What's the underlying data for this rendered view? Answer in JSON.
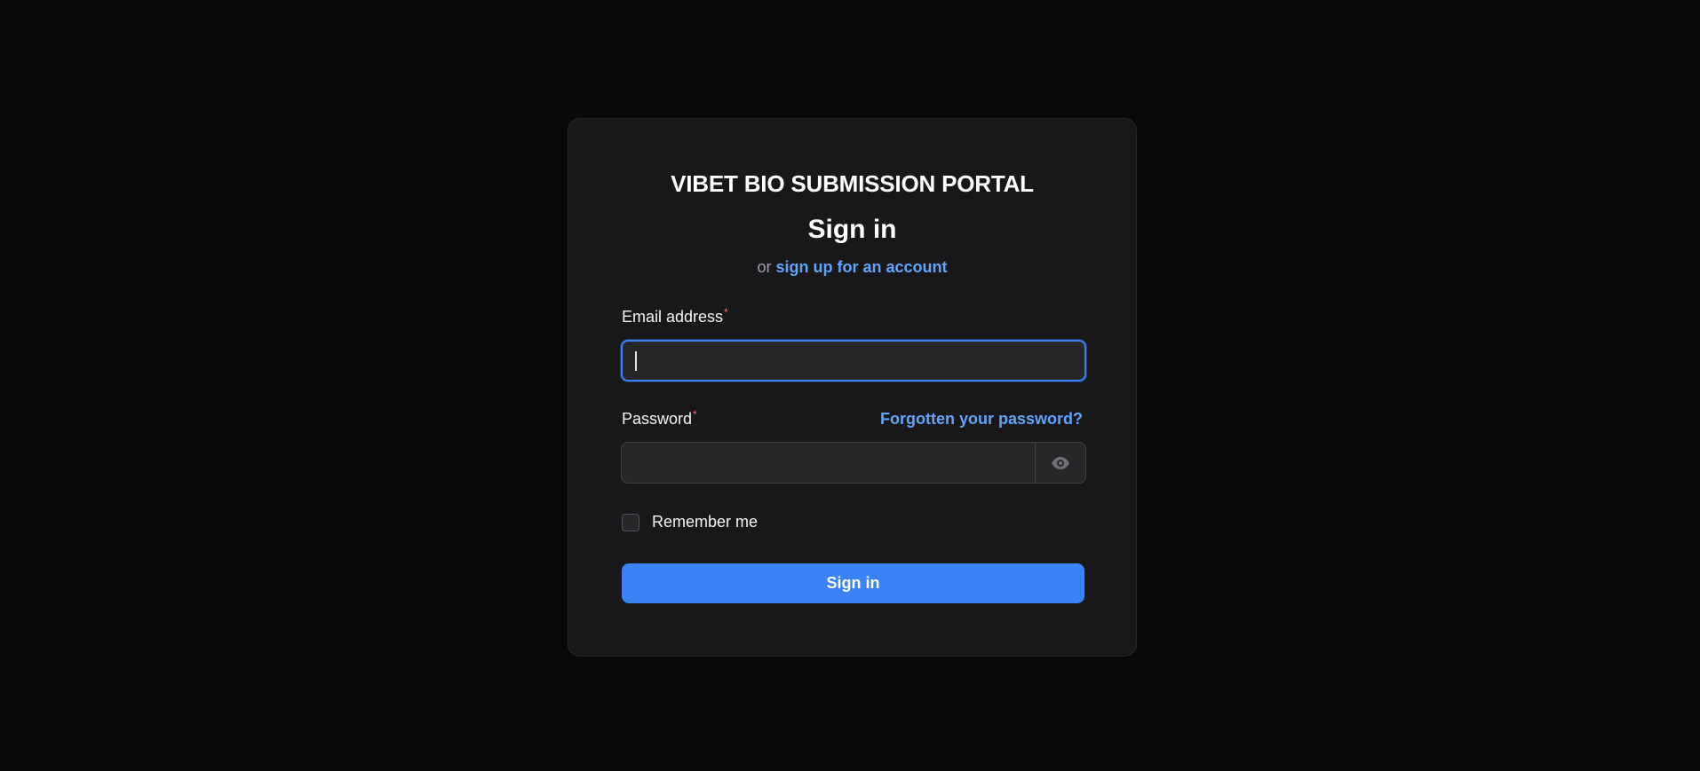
{
  "brand": {
    "title": "VIBET BIO SUBMISSION PORTAL"
  },
  "form": {
    "heading": "Sign in",
    "subline_prefix": "or",
    "signup_link": "sign up for an account",
    "email": {
      "label": "Email address",
      "required_mark": "*",
      "value": "",
      "placeholder": ""
    },
    "password": {
      "label": "Password",
      "required_mark": "*",
      "value": "",
      "placeholder": "",
      "forgot_link": "Forgotten your password?",
      "toggle_icon": "eye-icon"
    },
    "remember": {
      "label": "Remember me",
      "checked": false
    },
    "submit_label": "Sign in"
  },
  "colors": {
    "background": "#09090b",
    "card": "#18181b",
    "accent": "#3b82f6",
    "link": "#60a5fa",
    "required": "#f87171"
  }
}
